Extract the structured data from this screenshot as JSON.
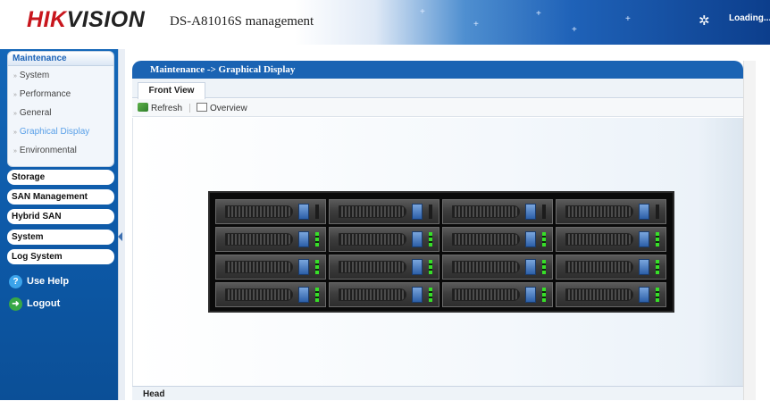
{
  "header": {
    "logo_hik": "HIK",
    "logo_vision": "VISION",
    "product_title": "DS-A81016S management",
    "status_text": "Loading...",
    "status_icon": "loading-spinner-icon"
  },
  "sidebar": {
    "maintenance": {
      "title": "Maintenance",
      "items": [
        {
          "label": "System"
        },
        {
          "label": "Performance"
        },
        {
          "label": "General"
        },
        {
          "label": "Graphical Display",
          "active": true
        },
        {
          "label": "Environmental"
        }
      ]
    },
    "groups": [
      {
        "label": "Storage"
      },
      {
        "label": "SAN Management"
      },
      {
        "label": "Hybrid SAN"
      },
      {
        "label": "System"
      },
      {
        "label": "Log System"
      }
    ],
    "use_help": "Use Help",
    "logout": "Logout"
  },
  "main": {
    "breadcrumb": "Maintenance -> Graphical Display",
    "tab_label": "Front View",
    "toolbar": {
      "refresh_label": "Refresh",
      "overview_label": "Overview"
    },
    "bottom_tab": "Head"
  },
  "enclosure": {
    "rows": 4,
    "columns": 4,
    "top_row_leds": "off",
    "other_rows_leds": "green"
  },
  "colors": {
    "accent_blue": "#1a63b3",
    "sidebar_blue": "#0d59a7",
    "logo_red": "#c8161d",
    "active_link": "#5aa0e8",
    "led_green": "#37e028"
  }
}
